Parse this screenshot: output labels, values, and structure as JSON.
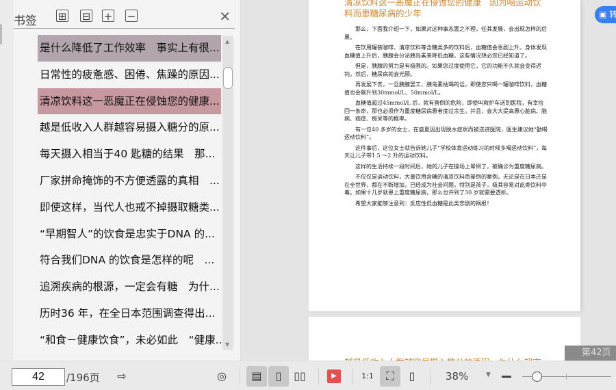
{
  "sidebar": {
    "title": "书签",
    "tool_icons": [
      "expand-all-icon",
      "collapse-all-icon",
      "add-bookmark-icon",
      "remove-bookmark-icon"
    ],
    "items": [
      {
        "label": "是什么降低了工作效率　事实上有很...",
        "state": "selected"
      },
      {
        "label": "日常性的疲惫感、困倦、焦躁的原因..."
      },
      {
        "label": "清凉饮料这一恶魔正在侵蚀您的健康...",
        "state": "current"
      },
      {
        "label": "越是低收入人群越容易摄入糖分的原..."
      },
      {
        "label": "每天摄入相当于40 匙糖的结果　那..."
      },
      {
        "label": "厂家拼命掩饰的不方便透露的真相　..."
      },
      {
        "label": "即使这样，当代人也戒不掉摄取糖类..."
      },
      {
        "label": "“早期智人”的饮食是忠实于DNA 的..."
      },
      {
        "label": "符合我们DNA 的饮食是怎样的呢　..."
      },
      {
        "label": "追溯疾病的根源，一定会有糖　为什..."
      },
      {
        "label": "历时36 年，在全日本范围调查得出..."
      },
      {
        "label": "“和食－健康饮食”，未必如此　“健康..."
      }
    ]
  },
  "page": {
    "title": "清凉饮料这一恶魔正在侵蚀您的健康　因为喝运动饮料而患糖尿病的少年",
    "paragraphs": [
      "那么，下面我介绍一下，如果对这种事态置之不理，任其发展，会出现怎样的后果。",
      "在饮用罐装咖啡、清凉饮料等含糖类多的饮料后，血糖值会急剧上升。身体发现血糖值上升后，胰腺会分泌胰岛素来降低血糖，这些情况想必您已经知道了。",
      "但是，胰腺的努力是有极限的。如果您过度使用它，它的功能不久就会变得迟钝，然后，糖尿病就会光顾。",
      "再发展下去，一旦胰腺罢工、胰岛素枯竭的话，即使您只喝一罐咖啡饮料，血糖值也会飙升到30mmol/L、50mmol/L。",
      "血糖值超过45mmol/L 后，就有昏倒的危险，即使叫救护车送到医院，有幸捡回一条命，那也必须作为重度糖尿病患者度过余生。并且，会大大提高患心脏病、脑病、癌症、痴呆等的概率。",
      "有一位40 多岁的女士，在盛夏因出现脱水症状而被送进医院，医生建议她“勤喝运动饮料”。",
      "这件事后，这位女士就告诉她儿子“学校体育运动练习的时候多喝运动饮料”，每天让儿子带1.5 ～2 升的运动饮料。",
      "这样的生活持续一段时间后，她的儿子在操场上晕倒了，被确诊为重度糖尿病。",
      "不仅仅是运动饮料，大量饮用含糖的清凉饮料而晕倒的案例，无论是在日本还是在全世界，都在不断增加，已经成为社会问题。特别是孩子，极其容易对此类饮料中毒。如果十几岁就患上重度糖尿病，那么也许到了30 岁就需要透析。",
      "希望大家能够注意到：反应性低血糖是此类悲剧的祸根！"
    ],
    "next_page_title": "越是低收入人群越容易摄入糖分的原因　为什么超市"
  },
  "convert_button": "转",
  "page_overlay": "第42页",
  "toolbar": {
    "current_page": "42",
    "total_pages": "/196页",
    "zoom": "38%",
    "zoom_level_percent": 38
  },
  "colors": {
    "accent": "#3a7ff0",
    "title_orange": "#d6842b",
    "selected_bg": "#b3a5ad",
    "current_bg": "#c7989f",
    "play_red": "#e45050"
  }
}
